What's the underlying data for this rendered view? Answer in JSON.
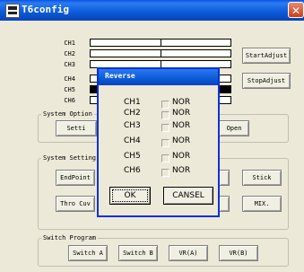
{
  "window": {
    "title": "T6config",
    "close_glyph": "✕"
  },
  "channels": {
    "labels": [
      "CH1",
      "CH2",
      "CH3",
      "CH4",
      "CH5",
      "CH6"
    ]
  },
  "buttons": {
    "start_adjust": "StartAdjust",
    "stop_adjust": "StopAdjust",
    "open": "Open",
    "settings_partial": "Setti",
    "endpoint": "EndPoint",
    "thro_cuv": "Thro Cuv",
    "stick": "Stick",
    "mix": "MIX."
  },
  "groups": {
    "system_option": "System Option",
    "system_setting": "System Setting",
    "switch_program": "Switch Program"
  },
  "switch_program": {
    "buttons": [
      "Switch A",
      "Switch B",
      "VR(A)",
      "VR(B)"
    ]
  },
  "dialog": {
    "title": "Reverse",
    "channels": [
      "CH1",
      "CH2",
      "CH3",
      "CH4",
      "CH5",
      "CH6"
    ],
    "option_label": "NOR",
    "ok": "OK",
    "cancel": "CANSEL"
  }
}
